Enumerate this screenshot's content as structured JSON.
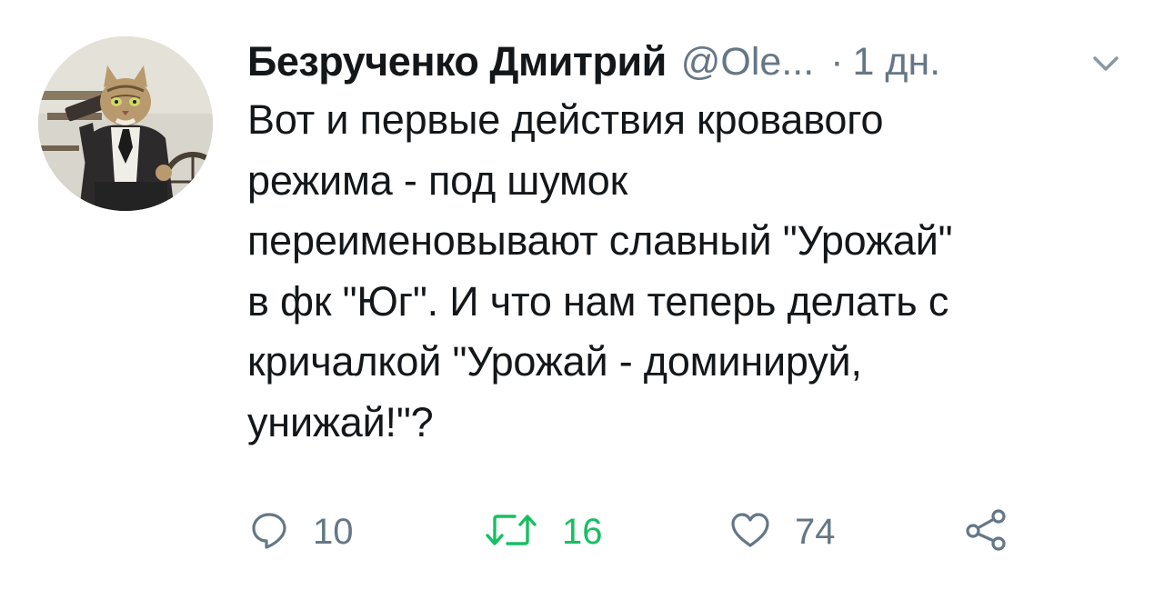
{
  "tweet": {
    "author_name": "Безрученко Дмитрий",
    "handle": "@Ole...",
    "separator": "·",
    "time": "1 дн.",
    "text": "Вот и первые действия кровавого\nрежима - под шумок\nпереименовывают славный \"Урожай\"\nв фк \"Юг\". И что нам теперь делать с\nкричалкой \"Урожай - доминируй,\nунижай!\"?"
  },
  "actions": {
    "replies": "10",
    "retweets": "16",
    "likes": "74"
  },
  "colors": {
    "text": "#14171a",
    "muted": "#657786",
    "retweet_active": "#17bf63"
  },
  "icons": {
    "reply": "speech-bubble-icon",
    "retweet": "retweet-arrows-icon",
    "like": "heart-icon",
    "share": "share-nodes-icon",
    "menu": "chevron-down-icon"
  }
}
